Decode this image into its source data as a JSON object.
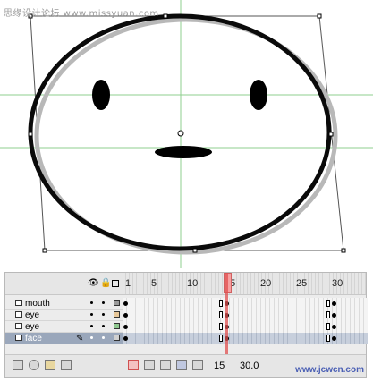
{
  "watermark_top": "思缘设计论坛 www.missyuan.com",
  "watermark_bottom": "www.jcwcn.com",
  "timeline": {
    "frame_numbers": [
      "1",
      "5",
      "10",
      "15",
      "20",
      "25",
      "30"
    ],
    "layers": [
      {
        "name": "mouth",
        "selected": false
      },
      {
        "name": "eye",
        "selected": false
      },
      {
        "name": "eye",
        "selected": false
      },
      {
        "name": "face",
        "selected": true
      }
    ],
    "footer": {
      "current_frame": "15",
      "fps": "30.0"
    }
  },
  "colors": {
    "guide": "#8fcf8f",
    "playhead": "#e05050",
    "selected_layer": "#9aa7bb"
  },
  "icons": {
    "header": [
      "eye-icon",
      "lock-icon",
      "outline-icon"
    ],
    "footer": [
      "insert-layer-icon",
      "add-guide-icon",
      "insert-folder-icon",
      "delete-layer-icon"
    ]
  }
}
